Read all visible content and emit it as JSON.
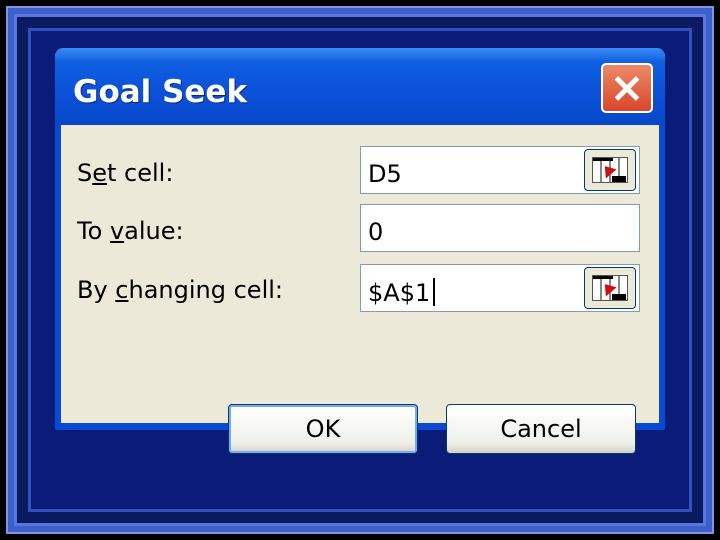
{
  "dialog": {
    "title": "Goal Seek",
    "close_icon": "close-icon"
  },
  "fields": {
    "set_cell": {
      "label_pre": "S",
      "label_u": "e",
      "label_post": "t cell:",
      "value": "D5"
    },
    "to_value": {
      "label_pre": "To ",
      "label_u": "v",
      "label_post": "alue:",
      "value": "0"
    },
    "changing_cell": {
      "label_pre": "By ",
      "label_u": "c",
      "label_post": "hanging cell:",
      "value": "$A$1"
    }
  },
  "buttons": {
    "ok": "OK",
    "cancel": "Cancel"
  },
  "colors": {
    "titlebar": "#0a50d8",
    "dialog_face": "#ece9d8",
    "close_button": "#d8472a",
    "slide_background": "#0b1c78"
  }
}
